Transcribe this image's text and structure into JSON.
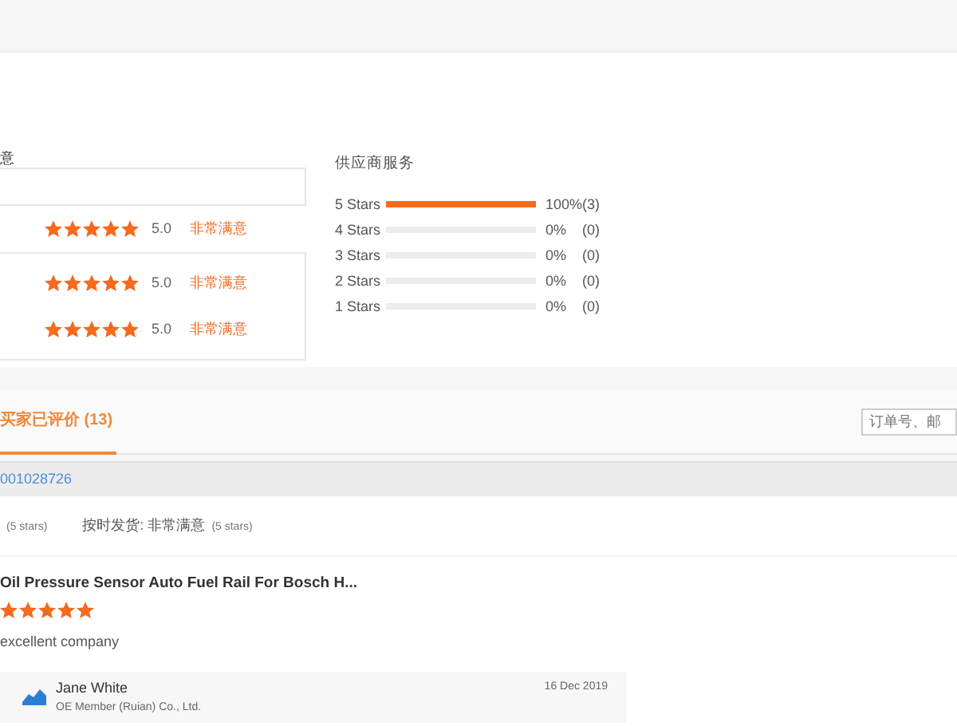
{
  "section_heading": "意",
  "satisfaction": [
    {
      "stars": 5,
      "score": "5.0",
      "label": "非常满意"
    },
    {
      "stars": 5,
      "score": "5.0",
      "label": "非常满意"
    },
    {
      "stars": 5,
      "score": "5.0",
      "label": "非常满意"
    }
  ],
  "supplier_service": {
    "title": "供应商服务",
    "rows": [
      {
        "label": "5 Stars",
        "level": 1,
        "percent": "100%",
        "count": "(3)"
      },
      {
        "label": "4 Stars",
        "level": 0,
        "percent": "0%",
        "count": "(0)"
      },
      {
        "label": "3 Stars",
        "level": 0,
        "percent": "0%",
        "count": "(0)"
      },
      {
        "label": "2 Stars",
        "level": 0,
        "percent": "0%",
        "count": "(0)"
      },
      {
        "label": "1 Stars",
        "level": 0,
        "percent": "0%",
        "count": "(0)"
      }
    ]
  },
  "tabs": [
    {
      "label": "买家已评价 (13)",
      "selected": true
    }
  ],
  "search": {
    "placeholder": "订单号、邮"
  },
  "order": {
    "number": "001028726"
  },
  "ratings_line": [
    {
      "stars_text": "(5 stars)"
    },
    {
      "label": "按时发货: 非常满意",
      "stars_text": "(5 stars)"
    }
  ],
  "review": {
    "product": "Oil Pressure Sensor Auto Fuel Rail For Bosch H...",
    "stars": 5,
    "comment": "excellent company",
    "reply": {
      "name": "Jane White",
      "company": "OE Member (Ruian) Co., Ltd.",
      "date": "16 Dec 2019"
    }
  }
}
